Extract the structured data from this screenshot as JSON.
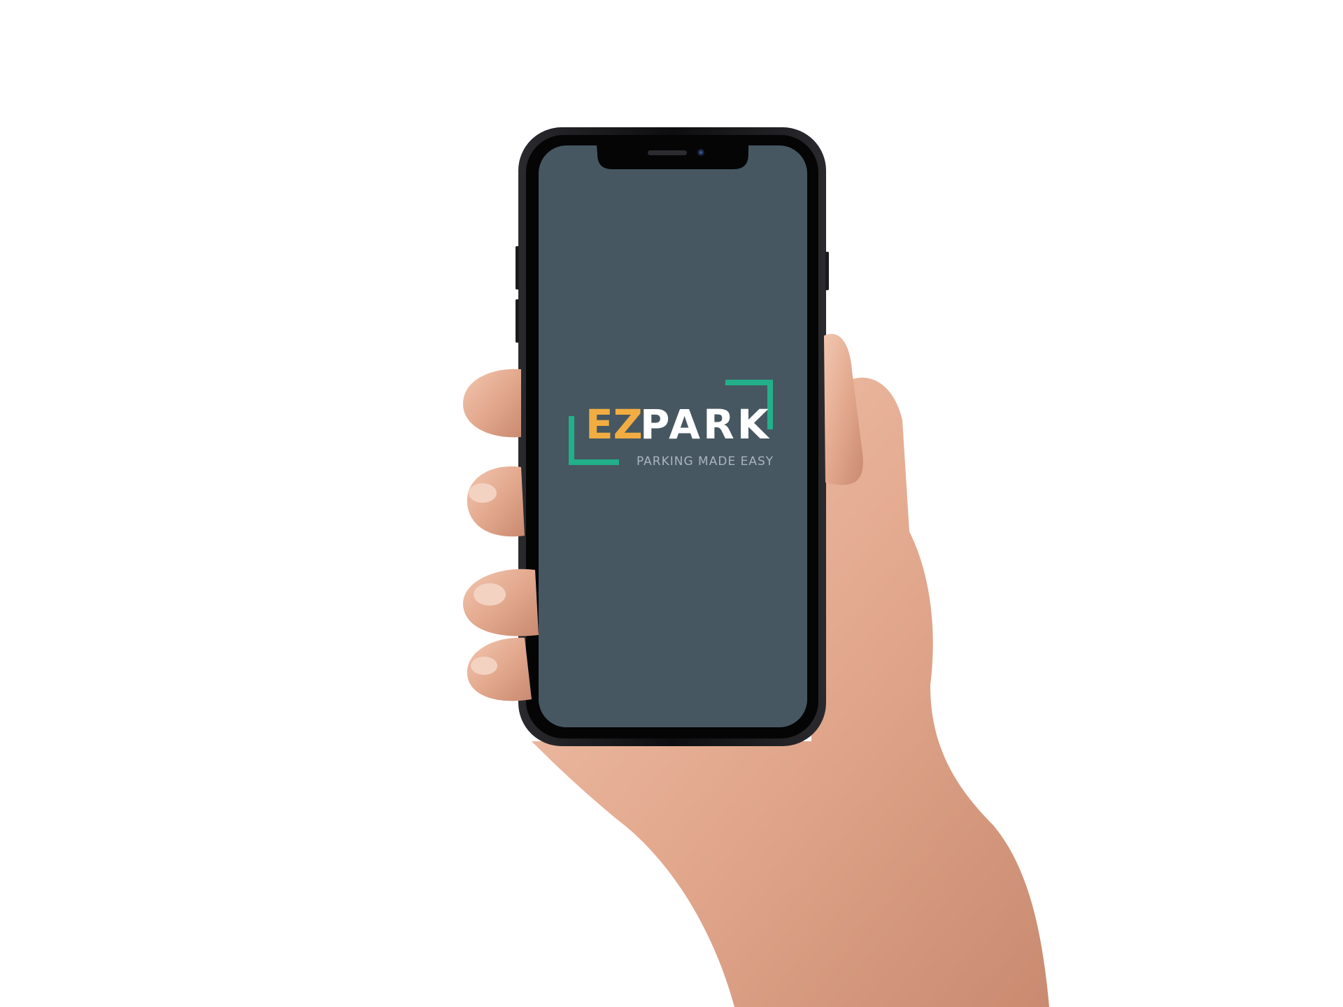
{
  "app": {
    "screen": "splash",
    "logo": {
      "part_accent": "EZ",
      "part_main": "PARK"
    },
    "tagline": "PARKING MADE EASY"
  },
  "colors": {
    "background": "#ffffff",
    "screen": "#475761",
    "phone_frame": "#141416",
    "accent_green": "#22b08a",
    "accent_orange": "#f2ad42",
    "logo_white": "#ffffff",
    "tagline_gray": "#a9b5bd",
    "skin": "#e8b49c"
  }
}
